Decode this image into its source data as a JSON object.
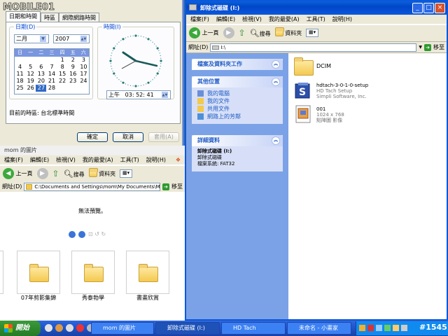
{
  "watermark": {
    "logo_text": "MOBILE01",
    "id_text": "#1545"
  },
  "datetime_window": {
    "tabs": [
      "日期和時間",
      "時區",
      "網際網路時間"
    ],
    "date_group_title": "日期(D)",
    "month": "二月",
    "year": "2007",
    "weekdays": [
      "日",
      "一",
      "二",
      "三",
      "四",
      "五",
      "六"
    ],
    "days": [
      "",
      "",
      "",
      "",
      "1",
      "2",
      "3",
      "4",
      "5",
      "6",
      "7",
      "8",
      "9",
      "10",
      "11",
      "12",
      "13",
      "14",
      "15",
      "16",
      "17",
      "18",
      "19",
      "20",
      "21",
      "22",
      "23",
      "24",
      "25",
      "26",
      "27",
      "28",
      "",
      "",
      ""
    ],
    "selected_day": "27",
    "time_group_title": "時間(I)",
    "ampm": "上午",
    "hour": "03",
    "minute": "52",
    "second": "41",
    "timezone_text": "目前的時區: 台北標準時間",
    "ok_label": "確定",
    "cancel_label": "取消",
    "apply_label": "套用(A)"
  },
  "pictures_window": {
    "title": "mom 的圖片",
    "menu": [
      "檔案(F)",
      "編輯(E)",
      "檢視(V)",
      "我的最愛(A)",
      "工具(T)",
      "說明(H)"
    ],
    "back_label": "上一頁",
    "search_label": "搜尋",
    "folders_label": "資料夾",
    "address_label": "網址(D)",
    "address_value": "C:\\Documents and Settings\\mom\\My Documents\\My Pictur",
    "go_label": "移至",
    "no_preview": "無法預覽。",
    "folders": [
      "07年剪影集錦",
      "秀泰勃學",
      "書畫欣賞"
    ]
  },
  "removable_window": {
    "title": "卸除式磁碟 (I:)",
    "menu": [
      "檔案(F)",
      "編輯(E)",
      "檢視(V)",
      "我的最愛(A)",
      "工具(T)",
      "說明(H)"
    ],
    "back_label": "上一頁",
    "search_label": "搜尋",
    "folders_label": "資料夾",
    "address_label": "網址(D)",
    "address_value": "I:\\",
    "go_label": "移至",
    "file_tasks_header": "檔案及資料夾工作",
    "other_places_header": "其他位置",
    "other_places": [
      "我的電腦",
      "我的文件",
      "共用文件",
      "網路上的芳鄰"
    ],
    "details_header": "詳細資料",
    "details_name": "卸除式磁碟 (I:)",
    "details_type": "卸除式磁碟",
    "details_fs": "檔案系統: FAT32",
    "files": [
      {
        "name": "DCIM",
        "line2": "",
        "line3": ""
      },
      {
        "name": "hdtach-3-0-1-0-setup",
        "line2": "HD Tach Setup",
        "line3": "Simpli Software, Inc."
      },
      {
        "name": "001",
        "line2": "1024 x 768",
        "line3": "點陣圖 影像"
      }
    ]
  },
  "taskbar": {
    "start_label": "開始",
    "tasks": [
      "mom 的圖片",
      "卸除式磁碟 (I:)",
      "HD Tach",
      "未命名 - 小畫家"
    ]
  },
  "colors": {
    "xp_blue": "#0a5fd8",
    "taskpane": "#7ba2e7",
    "folder": "#f3c94f"
  }
}
